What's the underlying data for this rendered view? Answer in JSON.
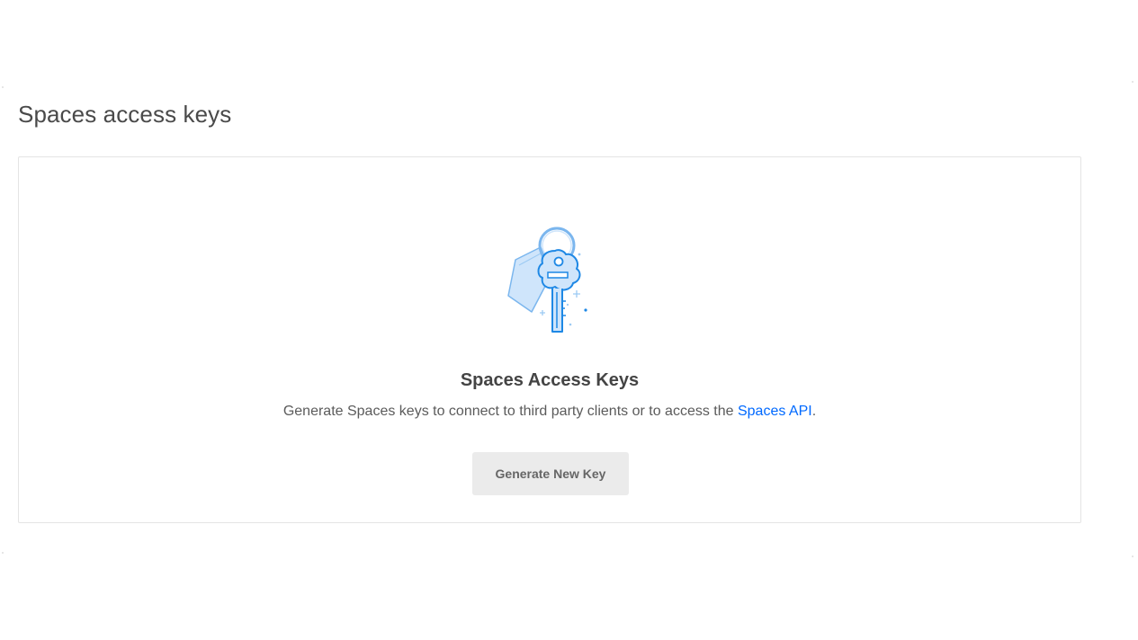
{
  "page": {
    "title": "Spaces access keys"
  },
  "empty_state": {
    "illustration_icon": "keychain-icon",
    "heading": "Spaces Access Keys",
    "description_prefix": "Generate Spaces keys to connect to third party clients or to access the ",
    "description_link": "Spaces API",
    "description_suffix": ".",
    "button_label": "Generate New Key"
  },
  "colors": {
    "accent": "#0069ff",
    "illustration_stroke": "#1e88e5",
    "illustration_fill": "#cfe5fb",
    "button_bg": "#ebebeb",
    "border": "#e4e4e4"
  }
}
